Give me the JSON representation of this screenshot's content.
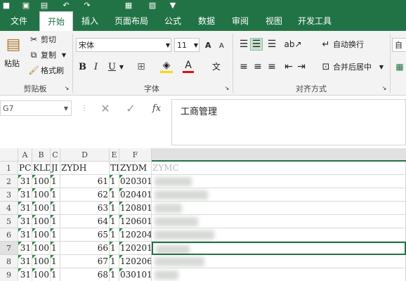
{
  "quick_access": {
    "app_icon": "excel-icon"
  },
  "tabs": [
    {
      "label": "文件",
      "active": false
    },
    {
      "label": "开始",
      "active": true
    },
    {
      "label": "插入",
      "active": false
    },
    {
      "label": "页面布局",
      "active": false
    },
    {
      "label": "公式",
      "active": false
    },
    {
      "label": "数据",
      "active": false
    },
    {
      "label": "审阅",
      "active": false
    },
    {
      "label": "视图",
      "active": false
    },
    {
      "label": "开发工具",
      "active": false
    }
  ],
  "clipboard": {
    "paste": "粘贴",
    "cut": "剪切",
    "copy": "复制",
    "format_painter": "格式刷",
    "group": "剪贴板"
  },
  "font": {
    "name": "宋体",
    "size": "11",
    "bold": "B",
    "italic": "I",
    "underline": "U",
    "group": "字体",
    "grow": "A",
    "shrink": "A"
  },
  "alignment": {
    "wrap": "自动换行",
    "merge": "合并后居中",
    "group": "对齐方式"
  },
  "partial_right": "自",
  "namebox": "G7",
  "formula": "工商管理",
  "fx": "fx",
  "columns": [
    "A",
    "B",
    "C",
    "D",
    "E",
    "F"
  ],
  "rows": [
    {
      "num": "1",
      "A": "PCI",
      "B": "KLDN",
      "C": "JI",
      "D": "ZYDH",
      "E": "TI",
      "F": "ZYDM",
      "G": "ZYMC"
    },
    {
      "num": "2",
      "A": "31",
      "B": "100",
      "C": "1",
      "D": "61",
      "E": "1",
      "F": "020301",
      "G": ""
    },
    {
      "num": "3",
      "A": "31",
      "B": "100",
      "C": "1",
      "D": "62",
      "E": "1",
      "F": "020401",
      "G": ""
    },
    {
      "num": "4",
      "A": "31",
      "B": "100",
      "C": "1",
      "D": "63",
      "E": "1",
      "F": "120801",
      "G": ""
    },
    {
      "num": "5",
      "A": "31",
      "B": "100",
      "C": "1",
      "D": "64",
      "E": "1",
      "F": "120601",
      "G": ""
    },
    {
      "num": "6",
      "A": "31",
      "B": "100",
      "C": "1",
      "D": "65",
      "E": "1",
      "F": "120204",
      "G": ""
    },
    {
      "num": "7",
      "A": "31",
      "B": "100",
      "C": "1",
      "D": "66",
      "E": "1",
      "F": "120201",
      "G": ""
    },
    {
      "num": "8",
      "A": "31",
      "B": "100",
      "C": "1",
      "D": "67",
      "E": "1",
      "F": "120206",
      "G": ""
    },
    {
      "num": "9",
      "A": "31",
      "B": "100",
      "C": "1",
      "D": "68",
      "E": "1",
      "F": "030101",
      "G": ""
    }
  ],
  "colors": {
    "accent": "#217346",
    "header_bg": "#f3f3f3",
    "marker": "#2a8a44"
  }
}
